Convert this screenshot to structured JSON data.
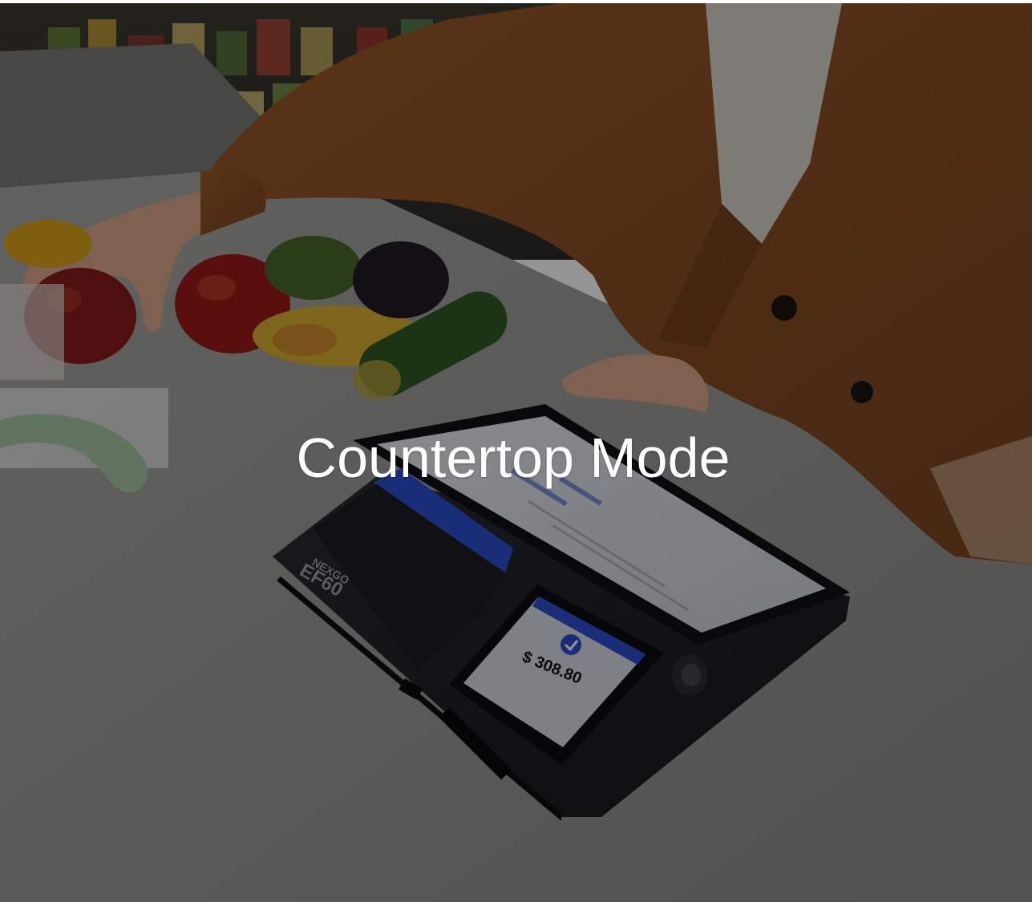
{
  "hero": {
    "title": "Countertop Mode",
    "overlay_color": "#000000",
    "device": {
      "brand": "NEXGO",
      "model": "EF60",
      "screen_status": "Payment succeeded",
      "screen_amount": "$ 308.80",
      "accent_color": "#2c4fcf"
    }
  }
}
